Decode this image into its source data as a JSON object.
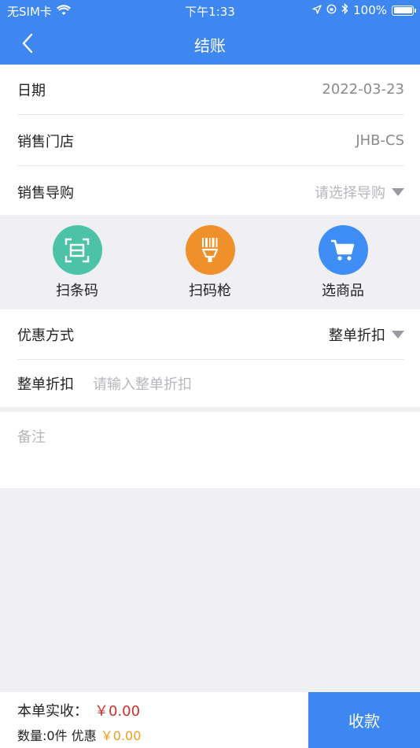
{
  "status_bar": {
    "carrier": "无SIM卡",
    "time": "下午1:33",
    "battery": "100%"
  },
  "nav": {
    "title": "结账"
  },
  "info": {
    "date_label": "日期",
    "date_value": "2022-03-23",
    "store_label": "销售门店",
    "store_value": "JHB-CS",
    "guide_label": "销售导购",
    "guide_placeholder": "请选择导购"
  },
  "actions": {
    "scan_barcode": "扫条码",
    "scan_gun": "扫码枪",
    "select_product": "选商品"
  },
  "discount": {
    "method_label": "优惠方式",
    "method_value": "整单折扣",
    "rate_label": "整单折扣",
    "rate_placeholder": "请输入整单折扣"
  },
  "remark": {
    "placeholder": "备注"
  },
  "footer": {
    "received_label": "本单实收：",
    "received_value": "￥0.00",
    "qty_text": "数量:0件 优惠",
    "discount_value": "￥0.00",
    "pay_button": "收款"
  },
  "colors": {
    "primary": "#3f87f0",
    "scan_barcode": "#4cc3a6",
    "scan_gun": "#f0902a",
    "select_product": "#3d8df5",
    "amount_red": "#c9302c",
    "discount_orange": "#f39b1a"
  }
}
